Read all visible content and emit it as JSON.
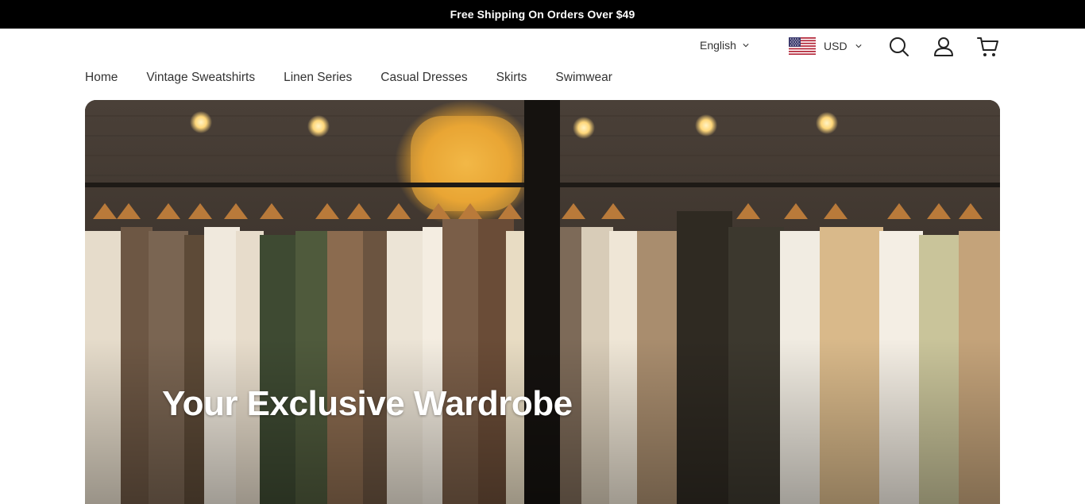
{
  "announcement": {
    "text": "Free Shipping On Orders Over $49"
  },
  "header": {
    "language": {
      "selected": "English",
      "icon": "chevron-down-icon"
    },
    "currency": {
      "selected": "USD",
      "flag": "us-flag-icon",
      "icon": "chevron-down-icon"
    },
    "icons": {
      "search": "search-icon",
      "account": "user-icon",
      "cart": "cart-icon"
    }
  },
  "nav": {
    "items": [
      {
        "label": "Home"
      },
      {
        "label": "Vintage Sweatshirts"
      },
      {
        "label": "Linen Series"
      },
      {
        "label": "Casual Dresses"
      },
      {
        "label": "Skirts"
      },
      {
        "label": "Swimwear"
      }
    ]
  },
  "hero": {
    "title": "Your Exclusive Wardrobe"
  },
  "colors": {
    "announcement_bg": "#000000",
    "announcement_text": "#ffffff",
    "hero_title": "#ffffff"
  }
}
